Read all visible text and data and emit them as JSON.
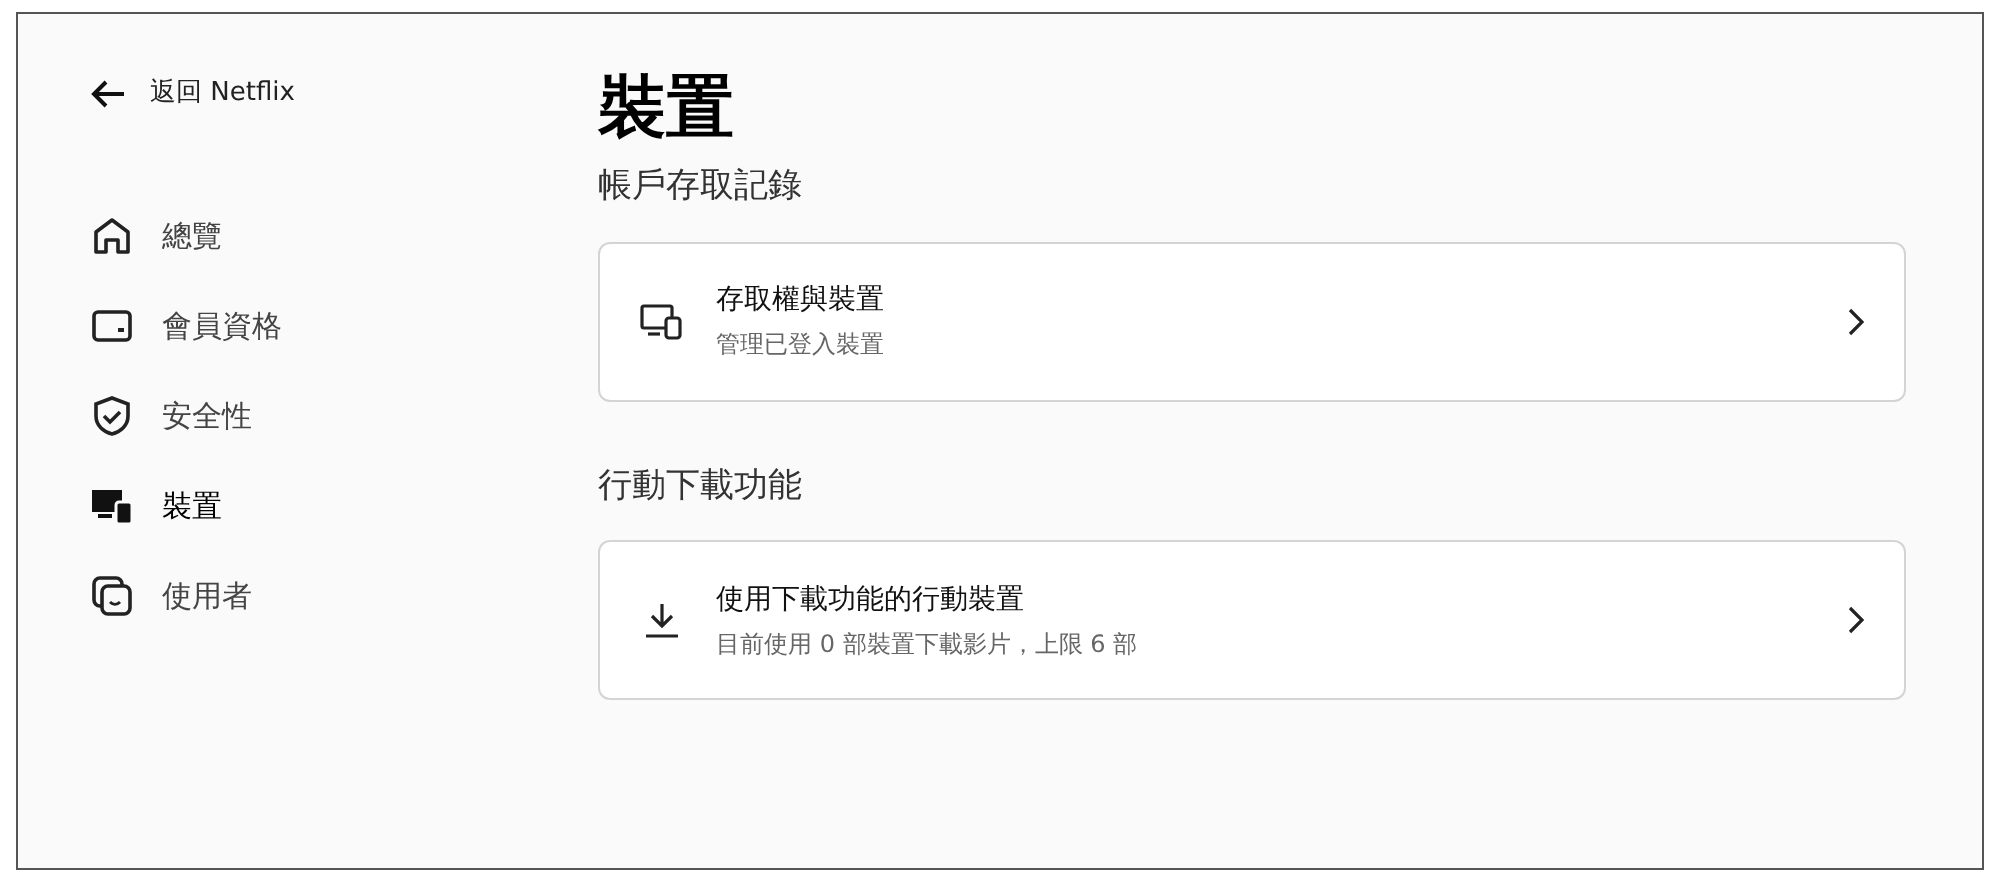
{
  "back_link": {
    "label": "返回 Netflix"
  },
  "sidebar": {
    "items": [
      {
        "label": "總覽",
        "selected": false
      },
      {
        "label": "會員資格",
        "selected": false
      },
      {
        "label": "安全性",
        "selected": false
      },
      {
        "label": "裝置",
        "selected": true
      },
      {
        "label": "使用者",
        "selected": false
      }
    ]
  },
  "page": {
    "title": "裝置",
    "sections": [
      {
        "heading": "帳戶存取記錄",
        "cards": [
          {
            "title": "存取權與裝置",
            "subtitle": "管理已登入裝置"
          }
        ]
      },
      {
        "heading": "行動下載功能",
        "cards": [
          {
            "title": "使用下載功能的行動裝置",
            "subtitle": "目前使用 0 部裝置下載影片，上限 6 部"
          }
        ]
      }
    ]
  }
}
